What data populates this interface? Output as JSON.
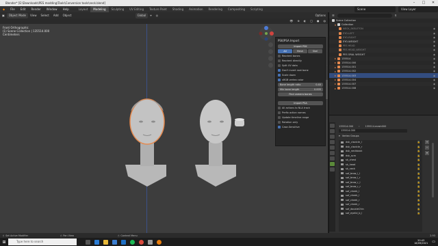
{
  "titlebar": {
    "title": "Blender* [E:\\Downloads\\PES modding\\Tools\\Conversion tools\\neck.blend]",
    "min": "–",
    "max": "□",
    "close": "✕"
  },
  "menu": [
    "File",
    "Edit",
    "Render",
    "Window",
    "Help"
  ],
  "workspace_tabs": [
    "Layout",
    "Modeling",
    "Sculpting",
    "UV Editing",
    "Texture Paint",
    "Shading",
    "Animation",
    "Rendering",
    "Compositing",
    "Scripting"
  ],
  "active_tab": "Modeling",
  "scene": "Scene",
  "view_layer": "View Layer",
  "viewport": {
    "mode": "Object Mode",
    "menus": [
      "View",
      "Select",
      "Add",
      "Object"
    ],
    "orientation": "Global",
    "options": "Options",
    "overlay_line1": "Front Orthographic",
    "overlay_line2": "(1) Scene Collection | 135514.000",
    "overlay_line3": "Centimeters"
  },
  "npanel": {
    "title": "PSK/PSA Import",
    "import_psk": "Import PSK",
    "seg": [
      "All",
      "Mesh",
      "Skel"
    ],
    "opts1": [
      {
        "label": "Reorient bones",
        "on": false
      },
      {
        "label": "Reorient directly",
        "on": false
      },
      {
        "label": "Split UV data",
        "on": false
      },
      {
        "label": "Don't invert root bone",
        "on": true
      },
      {
        "label": "Scale down",
        "on": true
      },
      {
        "label": "sRGB vertex color",
        "on": true
      }
    ],
    "bone_length_ratio_label": "Bone length ratio",
    "bone_length_ratio_val": "0.40",
    "min_bone_length_label": "Min bone length",
    "min_bone_length_val": "0.005",
    "find_camera": "Find camera bones",
    "import_psa": "Import PSA",
    "opts2": [
      {
        "label": "All actions to NLA track",
        "on": false
      },
      {
        "label": "Prefix action names",
        "on": false
      },
      {
        "label": "Update timeline range",
        "on": false
      },
      {
        "label": "Rotation only",
        "on": false
      },
      {
        "label": "Case-Sensitive",
        "on": true
      }
    ]
  },
  "outliner": {
    "header": "Scene Collection",
    "rows": [
      {
        "name": "Collection",
        "selected": false
      },
      {
        "name": "NECK_SKELETON",
        "selected": false
      },
      {
        "name": "EYO-LEFT",
        "selected": false
      },
      {
        "name": "EYO-RIGHT",
        "selected": false
      },
      {
        "name": "EYO-WEIGHT",
        "selected": false
      },
      {
        "name": "PES HEAD",
        "selected": false
      },
      {
        "name": "PES HEAD_WEIGHT",
        "selected": false
      },
      {
        "name": "PES ORAL WEIGHT",
        "selected": false
      },
      {
        "name": "135514",
        "selected": false
      },
      {
        "name": "135514.000",
        "selected": false
      },
      {
        "name": "135514.001",
        "selected": false
      },
      {
        "name": "135514.002",
        "selected": false
      },
      {
        "name": "135514.003",
        "selected": true
      },
      {
        "name": "135514.004",
        "selected": false
      },
      {
        "name": "135514.007",
        "selected": false
      },
      {
        "name": "135514.008",
        "selected": false
      }
    ]
  },
  "properties": {
    "object": "135514.000",
    "mesh": "135514.mesh000",
    "data_name": "135514.000",
    "panel": "Vertex Groups",
    "groups": [
      "dsk_clavicle_l",
      "dsk_clavicle_r",
      "dsk_neckback",
      "dsk_scm",
      "sk_chest",
      "sk_head",
      "sk_neck",
      "sof_brow_l_l",
      "sof_brow_l_r",
      "sof_brow_r_l",
      "sof_brow_r_r",
      "sof_cheek_l",
      "sof_cheek_l",
      "sof_cheek_r",
      "sof_cheek_r",
      "sof_doubleChin",
      "sof_eyelid_b_l"
    ]
  },
  "status": {
    "left": "Set Active Modifier",
    "middle": "Pan View",
    "right": "Context Menu",
    "version": "2.93"
  },
  "taskbar": {
    "search": "Type here to search",
    "time": "20:43",
    "date": "18/09/2021"
  }
}
